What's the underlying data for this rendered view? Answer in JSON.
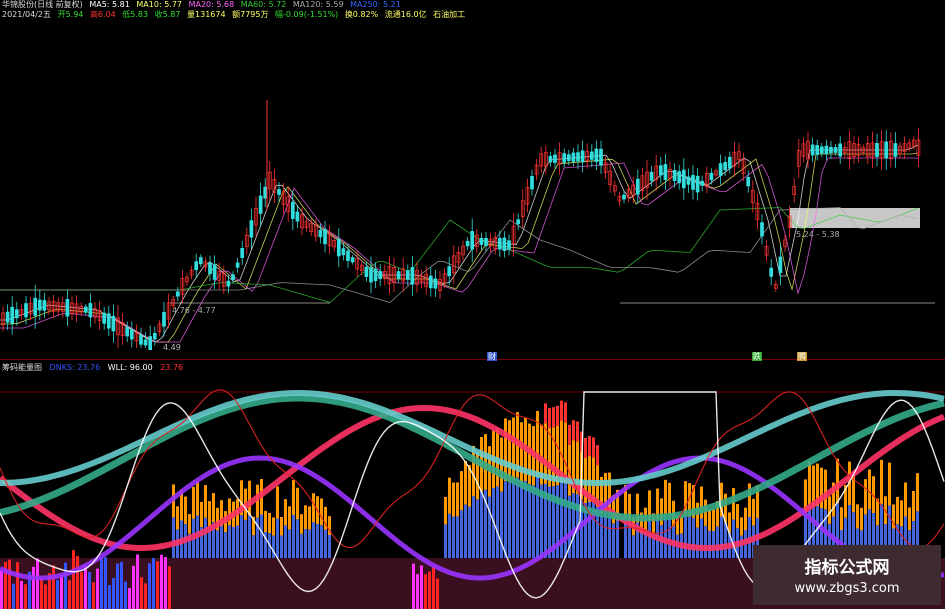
{
  "colors": {
    "background": "#000000",
    "up": "#ff3333",
    "down": "#33dddd",
    "ma5": "#ffffff",
    "ma10": "#ffff66",
    "ma20": "#ff66ff",
    "ma60": "#33cc33",
    "ma120": "#3366ff",
    "separator": "#7a0000"
  },
  "header": {
    "title": "华锦股份(日线 前复权)",
    "ma5": "MA5: 5.81",
    "ma10": "MA10: 5.77",
    "ma20": "MA20: 5.68",
    "ma60": "MA60: 5.72",
    "ma120": "MA120: 5.59",
    "ma250": "MA250: 5.21",
    "date": "2021/04/2五",
    "open": "开5.94",
    "high": "高6.04",
    "low": "低5.83",
    "close": "收5.87",
    "volume": "量131674",
    "amount": "额7795万",
    "change": "幅-0.09(-1.51%)",
    "turnover": "换0.82%",
    "float_cap": "流通16.0亿",
    "industry": "石油加工"
  },
  "price_labels": {
    "low_label": "4.49",
    "range_left": "4.76 - 4.77",
    "range_right": "5.24 - 5.38"
  },
  "flags": {
    "f1": "财",
    "f2": "跌",
    "f3": "腾"
  },
  "indicator": {
    "title": "筹码能量图",
    "value1_label": "DNKS: 23.76",
    "value2_label": "WLL: 96.00",
    "value3_label": "23.76"
  },
  "watermark": {
    "title": "指标公式网",
    "url": "www.zbgs3.com"
  }
}
